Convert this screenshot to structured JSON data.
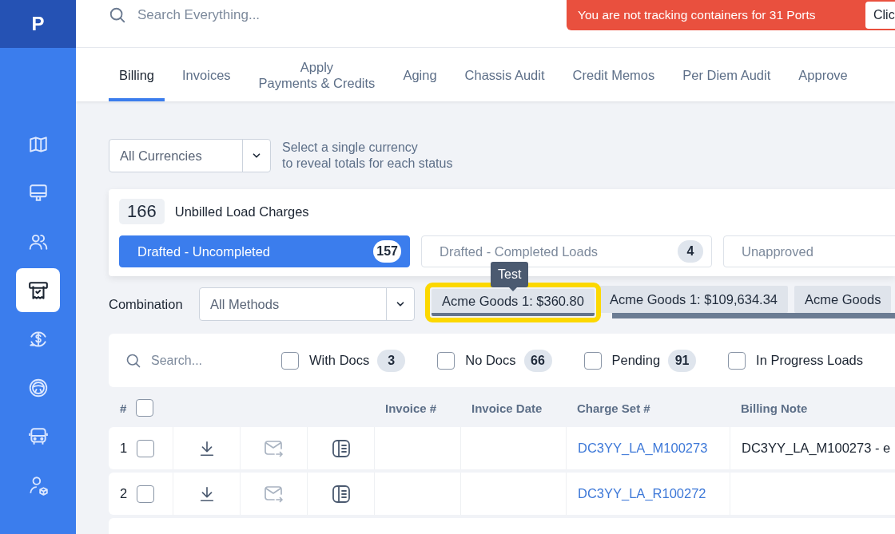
{
  "app": {
    "logo": "P"
  },
  "sidebar": {
    "items": [
      {
        "kind": "map",
        "selected": false
      },
      {
        "kind": "monitor",
        "selected": false
      },
      {
        "kind": "users",
        "selected": false
      },
      {
        "kind": "receipt",
        "selected": true
      },
      {
        "kind": "dollar",
        "selected": false
      },
      {
        "kind": "wheel",
        "selected": false
      },
      {
        "kind": "bus",
        "selected": false
      },
      {
        "kind": "user-box",
        "selected": false
      }
    ]
  },
  "search": {
    "placeholder": "Search Everything..."
  },
  "alert": {
    "message": "You are not tracking containers for 31 Ports",
    "button": "Clic"
  },
  "tabs": [
    {
      "label": "Billing",
      "selected": true
    },
    {
      "label": "Invoices",
      "selected": false
    },
    {
      "label": "Apply\nPayments & Credits",
      "selected": false
    },
    {
      "label": "Aging",
      "selected": false
    },
    {
      "label": "Chassis Audit",
      "selected": false
    },
    {
      "label": "Credit Memos",
      "selected": false
    },
    {
      "label": "Per Diem Audit",
      "selected": false
    },
    {
      "label": "Approve",
      "selected": false
    }
  ],
  "currency": {
    "value": "All Currencies",
    "hint": "Select a single currency\nto reveal totals for each status"
  },
  "summary": {
    "count": "166",
    "label": "Unbilled Load Charges",
    "statuses": [
      {
        "label": "Drafted - Uncompleted",
        "count": "157",
        "selected": true
      },
      {
        "label": "Drafted - Completed Loads",
        "count": "4",
        "selected": false
      },
      {
        "label": "Unapproved",
        "selected": false
      }
    ]
  },
  "combination": {
    "label": "Combination",
    "value": "All Methods",
    "tooltip": "Test",
    "chips": [
      {
        "label": "Acme Goods 1: $360.80",
        "selected": true
      },
      {
        "label": "Acme Goods 1: $109,634.34",
        "selected": false
      },
      {
        "label": "Acme Goods",
        "selected": false
      }
    ]
  },
  "filters": {
    "search_placeholder": "Search...",
    "options": [
      {
        "label": "With Docs",
        "count": "3",
        "checked": false
      },
      {
        "label": "No Docs",
        "count": "66",
        "checked": false
      },
      {
        "label": "Pending",
        "count": "91",
        "checked": false
      },
      {
        "label": "In Progress Loads",
        "checked": false
      }
    ]
  },
  "table": {
    "columns": [
      "#",
      "",
      "",
      "",
      "Invoice #",
      "Invoice Date",
      "Charge Set #",
      "Billing Note"
    ],
    "all_checked": false,
    "rows": [
      {
        "number": "1",
        "checked": false,
        "charge_set": "DC3YY_LA_M100273",
        "billing_note": "DC3YY_LA_M100273 - e"
      },
      {
        "number": "2",
        "checked": false,
        "charge_set": "DC3YY_LA_R100272"
      }
    ]
  }
}
